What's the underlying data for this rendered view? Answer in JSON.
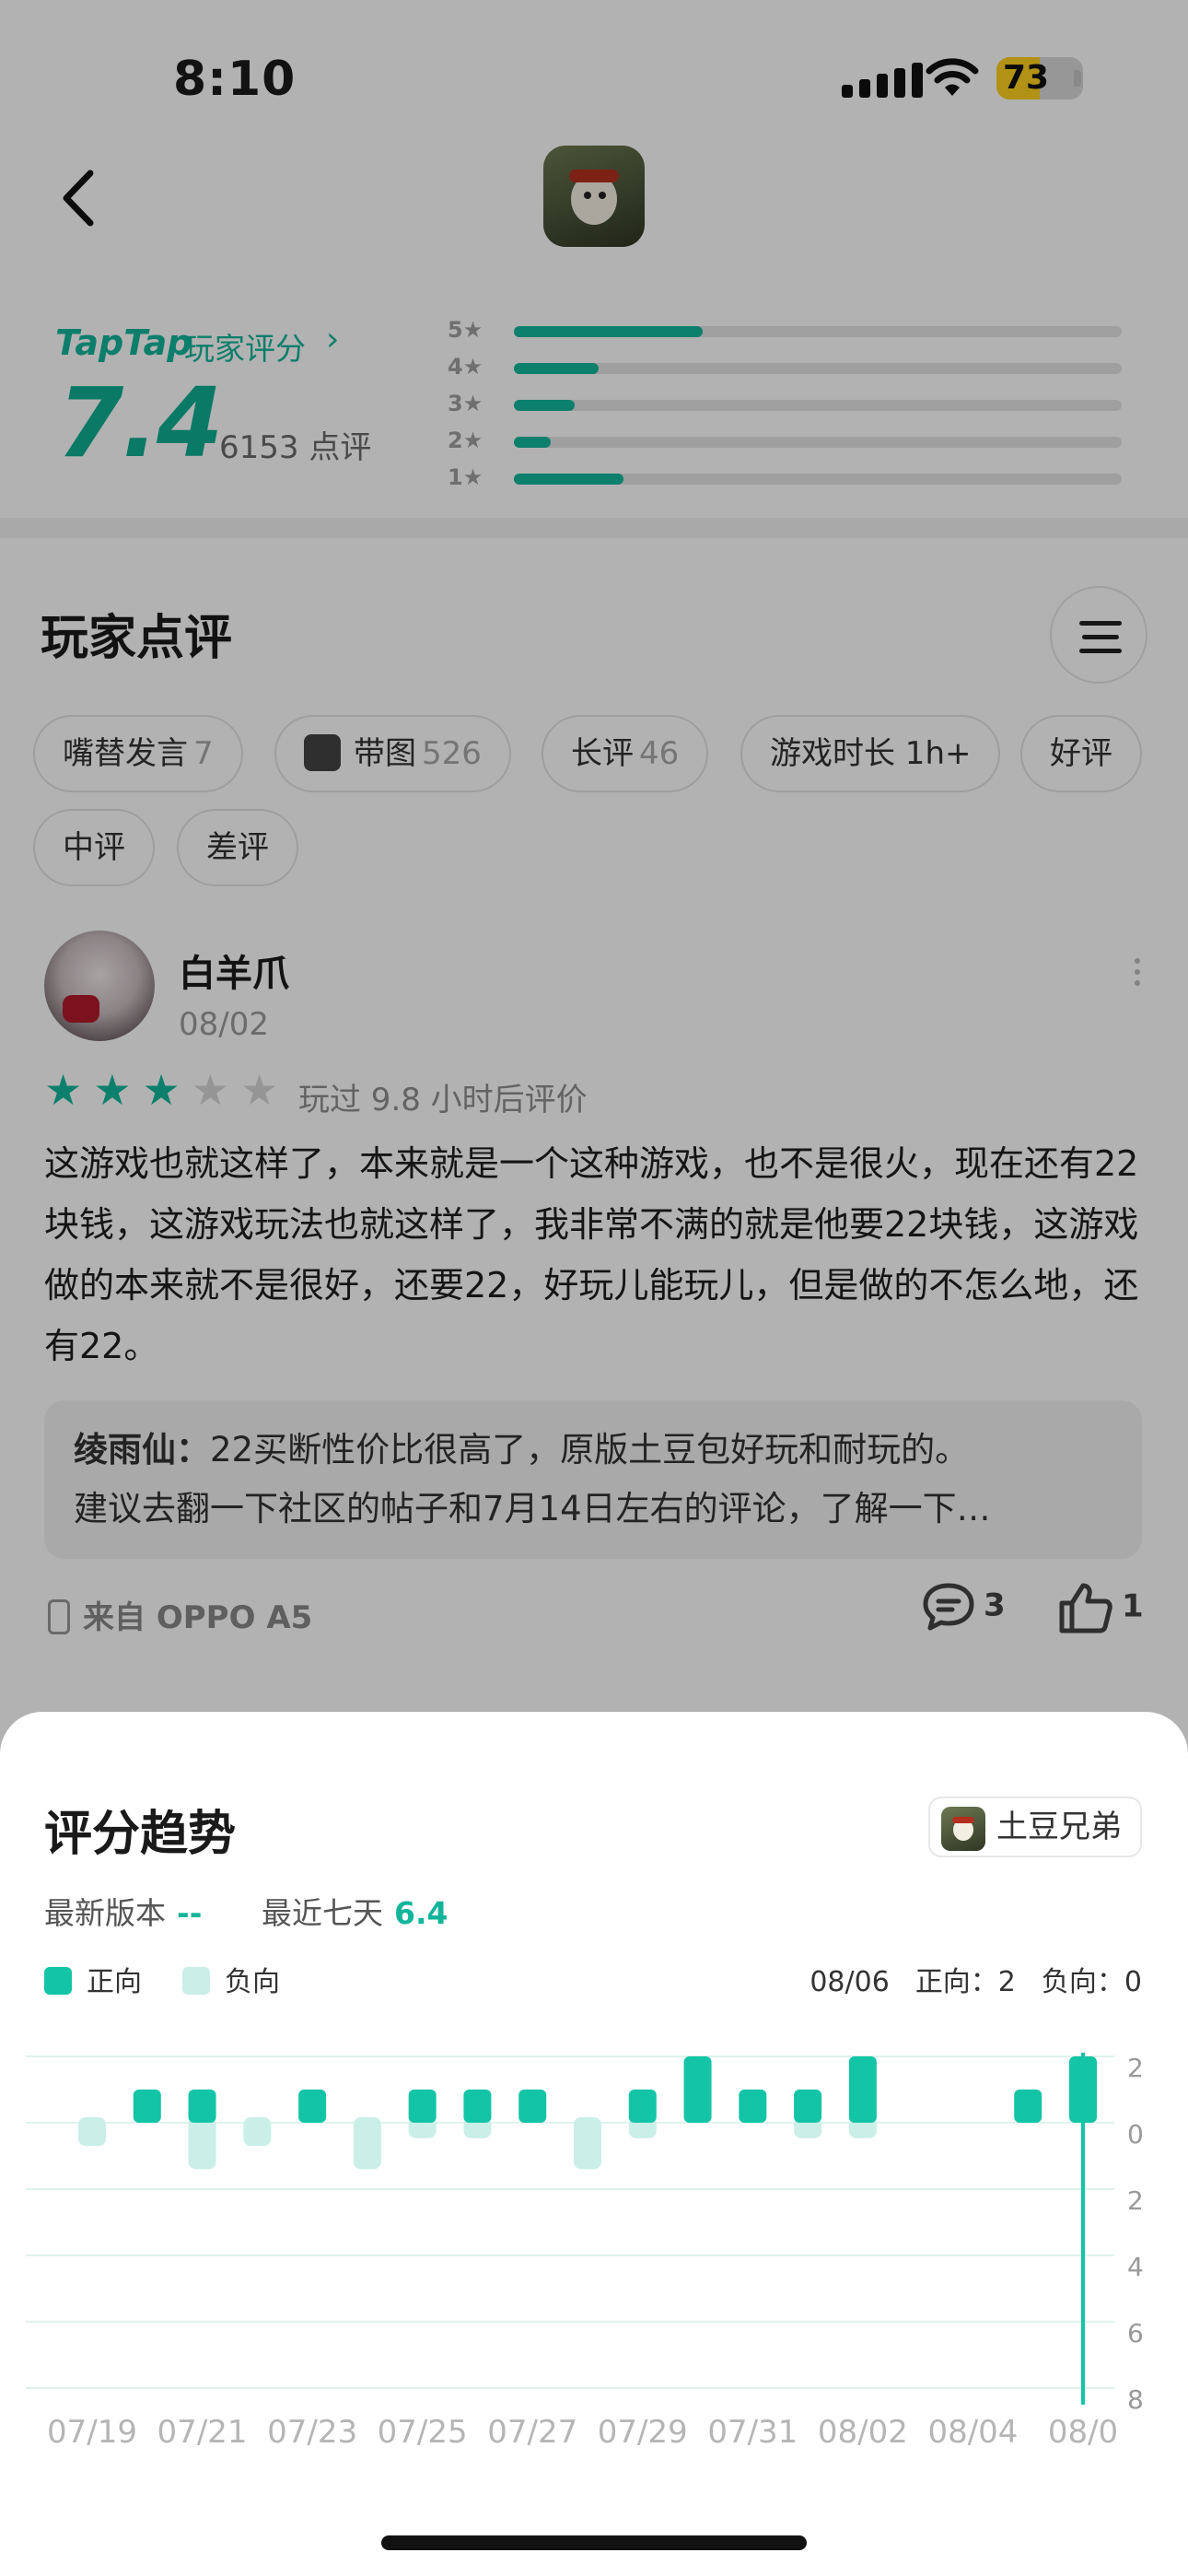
{
  "status_bar": {
    "time": "8:10",
    "battery": "73",
    "battery_level": 0.73
  },
  "rating": {
    "brand": "TapTap",
    "caption": "玩家评分",
    "chevron": "›",
    "score": "7.4",
    "review_count": "6153 点评",
    "distribution": [
      {
        "label": "5★",
        "fraction": 0.31
      },
      {
        "label": "4★",
        "fraction": 0.14
      },
      {
        "label": "3★",
        "fraction": 0.1
      },
      {
        "label": "2★",
        "fraction": 0.06
      },
      {
        "label": "1★",
        "fraction": 0.18
      }
    ]
  },
  "reviews_section": {
    "title": "玩家点评",
    "chips": [
      {
        "label": "嘴替发言",
        "count": "7"
      },
      {
        "label": "带图",
        "count": "526",
        "icon": "image-icon"
      },
      {
        "label": "长评",
        "count": "46"
      },
      {
        "label": "游戏时长 1h+",
        "count": ""
      },
      {
        "label": "好评",
        "count": ""
      },
      {
        "label": "中评",
        "count": ""
      },
      {
        "label": "差评",
        "count": ""
      }
    ]
  },
  "review": {
    "username": "白羊爪",
    "date": "08/02",
    "stars": 3,
    "played": "玩过 9.8 小时后评价",
    "body": "这游戏也就这样了，本来就是一个这种游戏，也不是很火，现在还有22块钱，这游戏玩法也就这样了，我非常不满的就是他要22块钱，这游戏做的本来就不是很好，还要22，好玩儿能玩儿，但是做的不怎么地，还有22。",
    "reply_author": "绫雨仙：",
    "reply_line1": "22买断性价比很高了，原版土豆包好玩和耐玩的。",
    "reply_line2": "建议去翻一下社区的帖子和7月14日左右的评论，了解一下…",
    "device": "来自 OPPO A5",
    "comments": "3",
    "likes": "1"
  },
  "trend_sheet": {
    "title": "评分趋势",
    "game_name": "土豆兄弟",
    "latest_version_label": "最新版本",
    "latest_version_value": "--",
    "recent_label": "最近七天",
    "recent_value": "6.4",
    "legend_positive": "正向",
    "legend_negative": "负向",
    "selected_date": "08/06",
    "selected_positive": "正向：2",
    "selected_negative": "负向：0",
    "colors": {
      "positive": "#14c4a6",
      "negative": "#c9efe8"
    }
  },
  "chart_data": {
    "type": "bar",
    "dates": [
      "07/19",
      "07/20",
      "07/21",
      "07/22",
      "07/23",
      "07/24",
      "07/25",
      "07/26",
      "07/27",
      "07/28",
      "07/29",
      "07/30",
      "07/31",
      "08/01",
      "08/02",
      "08/03",
      "08/04",
      "08/05",
      "08/06"
    ],
    "x_tick_labels": [
      "07/19",
      "07/21",
      "07/23",
      "07/25",
      "07/27",
      "07/29",
      "07/31",
      "08/02",
      "08/04",
      "08/0"
    ],
    "series": [
      {
        "name": "正向",
        "values": [
          0,
          1,
          1,
          0,
          1,
          0,
          1,
          1,
          1,
          0,
          1,
          2,
          1,
          1,
          2,
          0,
          0,
          1,
          2
        ]
      },
      {
        "name": "负向",
        "values": [
          0.6,
          0,
          1.2,
          0.6,
          0,
          1.2,
          0.4,
          0.4,
          0,
          1.2,
          0.4,
          0,
          0,
          0.4,
          0.4,
          0,
          0,
          0,
          0
        ]
      }
    ],
    "y_ticks_positive": [
      "2"
    ],
    "y_ticks_negative": [
      "0",
      "2",
      "4",
      "6",
      "8"
    ],
    "ylim": [
      -8,
      2
    ],
    "selected_index": 18
  }
}
